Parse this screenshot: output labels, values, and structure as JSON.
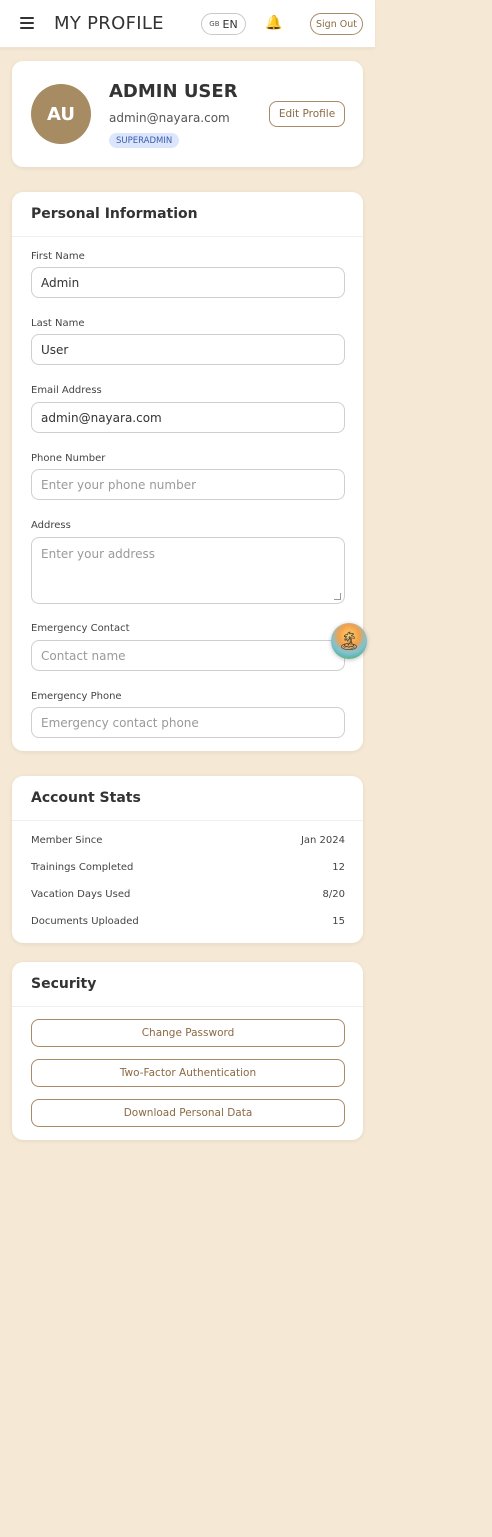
{
  "header": {
    "title": "MY PROFILE",
    "lang_flag": "GB",
    "lang_label": "EN",
    "signout_label": "Sign Out",
    "menu_icon": "hamburger-icon",
    "bell_icon": "bell-icon"
  },
  "profile": {
    "initials": "AU",
    "name": "ADMIN USER",
    "email": "admin@nayara.com",
    "role": "SUPERADMIN",
    "edit_label": "Edit Profile"
  },
  "personal": {
    "title": "Personal Information",
    "first_name_label": "First Name",
    "first_name_value": "Admin",
    "last_name_label": "Last Name",
    "last_name_value": "User",
    "email_label": "Email Address",
    "email_value": "admin@nayara.com",
    "phone_label": "Phone Number",
    "phone_placeholder": "Enter your phone number",
    "address_label": "Address",
    "address_placeholder": "Enter your address",
    "emergency_contact_label": "Emergency Contact",
    "emergency_contact_placeholder": "Contact name",
    "emergency_phone_label": "Emergency Phone",
    "emergency_phone_placeholder": "Emergency contact phone"
  },
  "stats": {
    "title": "Account Stats",
    "rows": [
      {
        "label": "Member Since",
        "value": "Jan 2024"
      },
      {
        "label": "Trainings Completed",
        "value": "12"
      },
      {
        "label": "Vacation Days Used",
        "value": "8/20"
      },
      {
        "label": "Documents Uploaded",
        "value": "15"
      }
    ]
  },
  "security": {
    "title": "Security",
    "change_password": "Change Password",
    "two_factor": "Two-Factor Authentication",
    "download_data": "Download Personal Data"
  },
  "colors": {
    "background": "#f5e9d5",
    "accent": "#a88a66",
    "avatar": "#a78b62",
    "role_badge": "#dbe5fb"
  }
}
